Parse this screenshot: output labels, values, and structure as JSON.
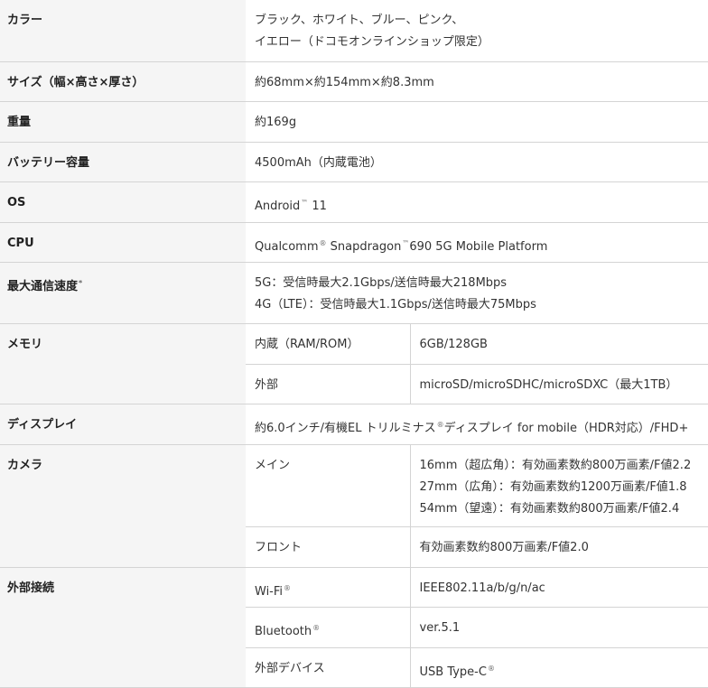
{
  "rows": {
    "color": {
      "label": "カラー",
      "lines": [
        "ブラック、ホワイト、ブルー、ピンク、",
        "イエロー（ドコモオンラインショップ限定）"
      ]
    },
    "size": {
      "label": "サイズ（幅×高さ×厚さ）",
      "value": "約68mm×約154mm×約8.3mm"
    },
    "weight": {
      "label": "重量",
      "value": "約169g"
    },
    "battery": {
      "label": "バッテリー容量",
      "value": "4500mAh（内蔵電池）"
    },
    "os": {
      "label": "OS",
      "value_a": "Android",
      "tm": "™",
      "value_b": " 11"
    },
    "cpu": {
      "label": "CPU",
      "value_a": "Qualcomm",
      "reg": "®",
      "value_b": " Snapdragon",
      "tm": "™",
      "value_c": "690 5G Mobile Platform"
    },
    "speed": {
      "label": "最大通信速度",
      "note": "*",
      "lines": [
        "5G：受信時最大2.1Gbps/送信時最大218Mbps",
        "4G（LTE）：受信時最大1.1Gbps/送信時最大75Mbps"
      ]
    },
    "memory": {
      "label": "メモリ",
      "internal_label": "内蔵（RAM/ROM）",
      "internal_value": "6GB/128GB",
      "external_label": "外部",
      "external_value": "microSD/microSDHC/microSDXC（最大1TB）"
    },
    "display": {
      "label": "ディスプレイ",
      "value_a": "約6.0インチ/有機EL トリルミナス",
      "reg": "®",
      "value_b": "ディスプレイ for mobile（HDR対応）/FHD+"
    },
    "camera": {
      "label": "カメラ",
      "main_label": "メイン",
      "main_lines": [
        "16mm（超広角）：有効画素数約800万画素/F値2.2",
        "27mm（広角）：有効画素数約1200万画素/F値1.8",
        "54mm（望遠）：有効画素数約800万画素/F値2.4"
      ],
      "front_label": "フロント",
      "front_value": "有効画素数約800万画素/F値2.0"
    },
    "connectivity": {
      "label": "外部接続",
      "wifi_label": "Wi-Fi",
      "wifi_reg": "®",
      "wifi_value": "IEEE802.11a/b/g/n/ac",
      "bt_label": "Bluetooth",
      "bt_reg": "®",
      "bt_value": "ver.5.1",
      "device_label": "外部デバイス",
      "device_value": "USB Type-C",
      "device_reg": "®"
    }
  }
}
